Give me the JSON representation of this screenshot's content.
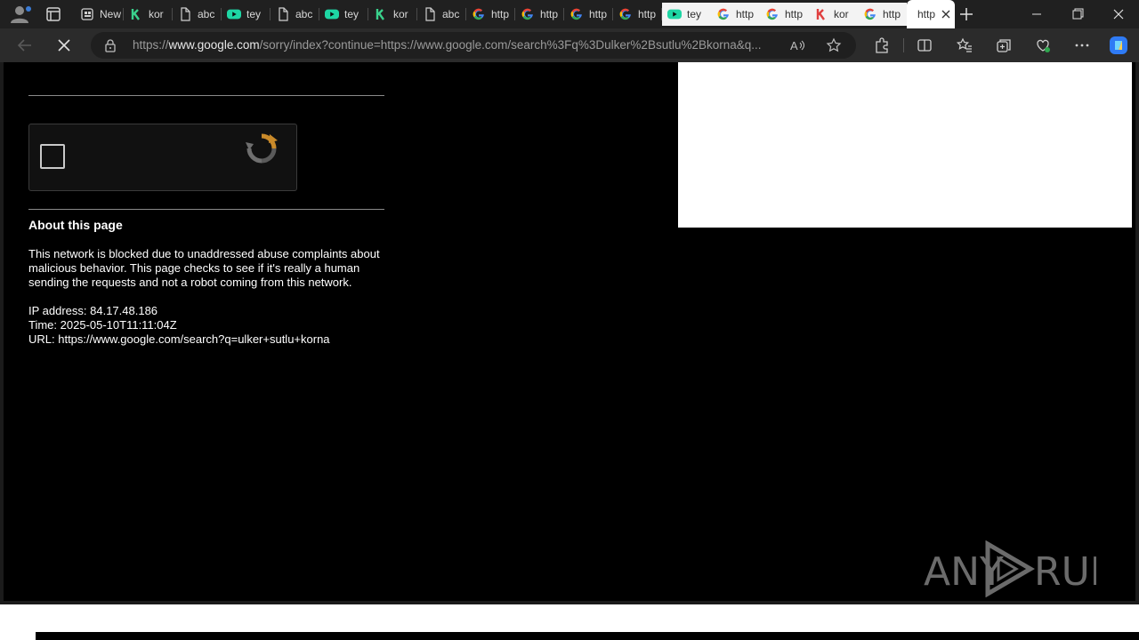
{
  "browser": {
    "tabs": [
      {
        "label": "New",
        "icon": "new-tab-page-icon",
        "light": false
      },
      {
        "label": "kor",
        "icon": "green-k-icon",
        "light": false
      },
      {
        "label": "abc",
        "icon": "document-icon",
        "light": false
      },
      {
        "label": "tey",
        "icon": "youtube-icon",
        "light": false
      },
      {
        "label": "abc",
        "icon": "document-icon",
        "light": false
      },
      {
        "label": "tey",
        "icon": "youtube-icon",
        "light": false
      },
      {
        "label": "kor",
        "icon": "green-k-icon",
        "light": false
      },
      {
        "label": "abc",
        "icon": "document-icon",
        "light": false
      },
      {
        "label": "http",
        "icon": "google-icon",
        "light": false
      },
      {
        "label": "http",
        "icon": "google-icon",
        "light": false
      },
      {
        "label": "http",
        "icon": "google-icon",
        "light": false
      },
      {
        "label": "http",
        "icon": "google-icon",
        "light": false
      },
      {
        "label": "tey",
        "icon": "youtube-icon",
        "light": true
      },
      {
        "label": "http",
        "icon": "google-icon",
        "light": true
      },
      {
        "label": "http",
        "icon": "google-icon",
        "light": true
      },
      {
        "label": "kor",
        "icon": "red-k-icon",
        "light": true
      },
      {
        "label": "http",
        "icon": "google-icon",
        "light": true
      },
      {
        "label": "http",
        "icon": "none",
        "light": true
      }
    ],
    "address": {
      "url_prefix": "https://",
      "url_host": "www.google.com",
      "url_path": "/sorry/index?continue=https://www.google.com/search%3Fq%3Dulker%2Bsutlu%2Bkorna&q..."
    }
  },
  "page": {
    "about_title": "About this page",
    "about_text": "This network is blocked due to unaddressed abuse complaints about malicious behavior. This page checks to see if it's really a human sending the requests and not a robot coming from this network.",
    "ip_line": "IP address: 84.17.48.186",
    "time_line": "Time: 2025-05-10T11:11:04Z",
    "url_line": "URL: https://www.google.com/search?q=ulker+sutlu+korna"
  },
  "watermark": {
    "text_left": "ANY",
    "text_right": "RUN"
  },
  "colors": {
    "tabstrip": "#202020",
    "toolbar": "#2b2b2b",
    "page_bg": "#000000",
    "active_tab": "#ffffff",
    "copilot": "#2f7bf5"
  }
}
